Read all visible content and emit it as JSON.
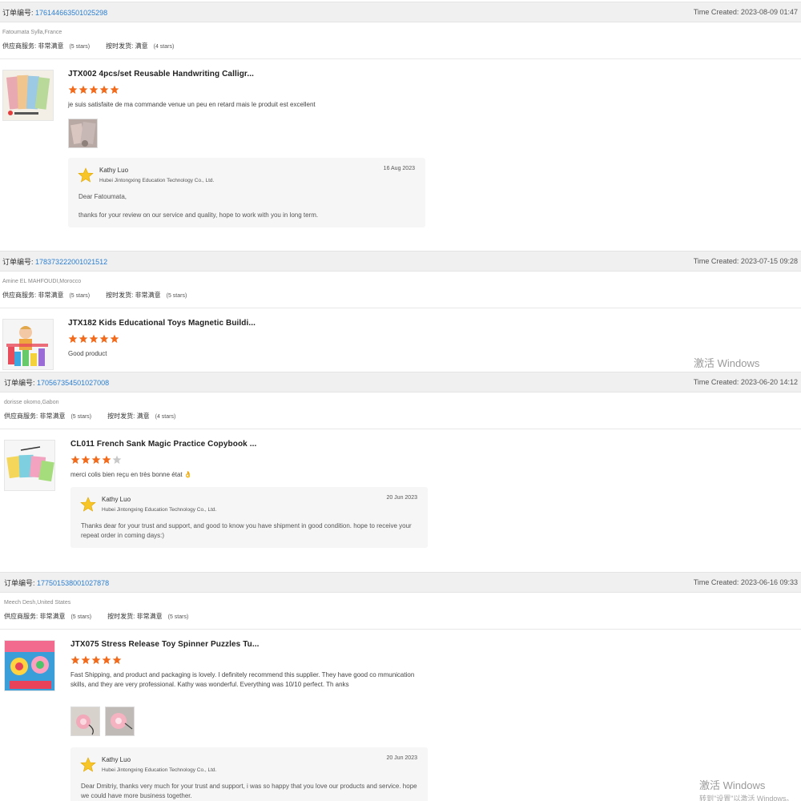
{
  "orders": [
    {
      "order_label": "订单编号:",
      "order_no": "176144663501025298",
      "time_created": "Time Created: 2023-08-09 01:47",
      "buyer": "Fatoumata Sylla,France",
      "rating1_label": "供应商服务:",
      "rating1_value": "非常满意",
      "rating1_stars": "(5 stars)",
      "rating2_label": "按时发货:",
      "rating2_value": "满意",
      "rating2_stars": "(4 stars)",
      "product_title": "JTX002 4pcs/set Reusable Handwriting Calligr...",
      "product_rating": 5,
      "comment": "je suis satisfaite de ma commande venue un peu en retard mais le produit est excellent",
      "reply": {
        "name": "Kathy Luo",
        "company": "Hubei Jintongxing Education Technology Co., Ltd.",
        "date": "16 Aug 2023",
        "line1": "Dear Fatoumata,",
        "line2": "thanks for your review on our service and quality, hope to work with you in long term."
      }
    },
    {
      "order_label": "订单编号:",
      "order_no": "178373222001021512",
      "time_created": "Time Created: 2023-07-15 09:28",
      "buyer": "Amine EL MAHFOUDI,Morocco",
      "rating1_label": "供应商服务:",
      "rating1_value": "非常满意",
      "rating1_stars": "(5 stars)",
      "rating2_label": "按时发货:",
      "rating2_value": "非常满意",
      "rating2_stars": "(5 stars)",
      "product_title": "JTX182 Kids Educational Toys Magnetic Buildi...",
      "product_rating": 5,
      "comment": "Good product"
    },
    {
      "order_label": "订单编号:",
      "order_no": "170567354501027008",
      "time_created": "Time Created: 2023-06-20 14:12",
      "buyer": "dorisse okomo,Gabon",
      "rating1_label": "供应商服务:",
      "rating1_value": "非常满意",
      "rating1_stars": "(5 stars)",
      "rating2_label": "按时发货:",
      "rating2_value": "满意",
      "rating2_stars": "(4 stars)",
      "product_title": "CL011 French Sank Magic Practice Copybook ...",
      "product_rating": 4,
      "comment": "merci colis bien reçu en très bonne état 👌",
      "reply": {
        "name": "Kathy Luo",
        "company": "Hubei Jintongxing Education Technology Co., Ltd.",
        "date": "20 Jun 2023",
        "line1": "Thanks dear for your trust and support, and good to know you have shipment in good condition. hope to receive your repeat order in coming days:)"
      }
    },
    {
      "order_label": "订单编号:",
      "order_no": "177501538001027878",
      "time_created": "Time Created: 2023-06-16 09:33",
      "buyer": "Meech Desh,United States",
      "rating1_label": "供应商服务:",
      "rating1_value": "非常满意",
      "rating1_stars": "(5 stars)",
      "rating2_label": "按时发货:",
      "rating2_value": "非常满意",
      "rating2_stars": "(5 stars)",
      "product_title": "JTX075 Stress Release Toy Spinner Puzzles Tu...",
      "product_rating": 5,
      "comment": "Fast Shipping, and product and packaging is lovely. I definitely recommend this supplier. They have good co mmunication skills, and they are very professional. Kathy was wonderful. Everything was 10/10 perfect. Th anks",
      "reply": {
        "name": "Kathy Luo",
        "company": "Hubei Jintongxing Education Technology Co., Ltd.",
        "date": "20 Jun 2023",
        "line1": "Dear Dmitriy, thanks very much for your trust and support, i was so happy that you love our products and service. hope we could have more business together."
      }
    }
  ],
  "watermark": {
    "title": "激活 Windows",
    "subtitle": "转到\"设置\"以激活 Windows。"
  },
  "colors": {
    "star": "#f26a1b",
    "star_empty": "#c8c8c8",
    "link": "#2b7fd0"
  }
}
